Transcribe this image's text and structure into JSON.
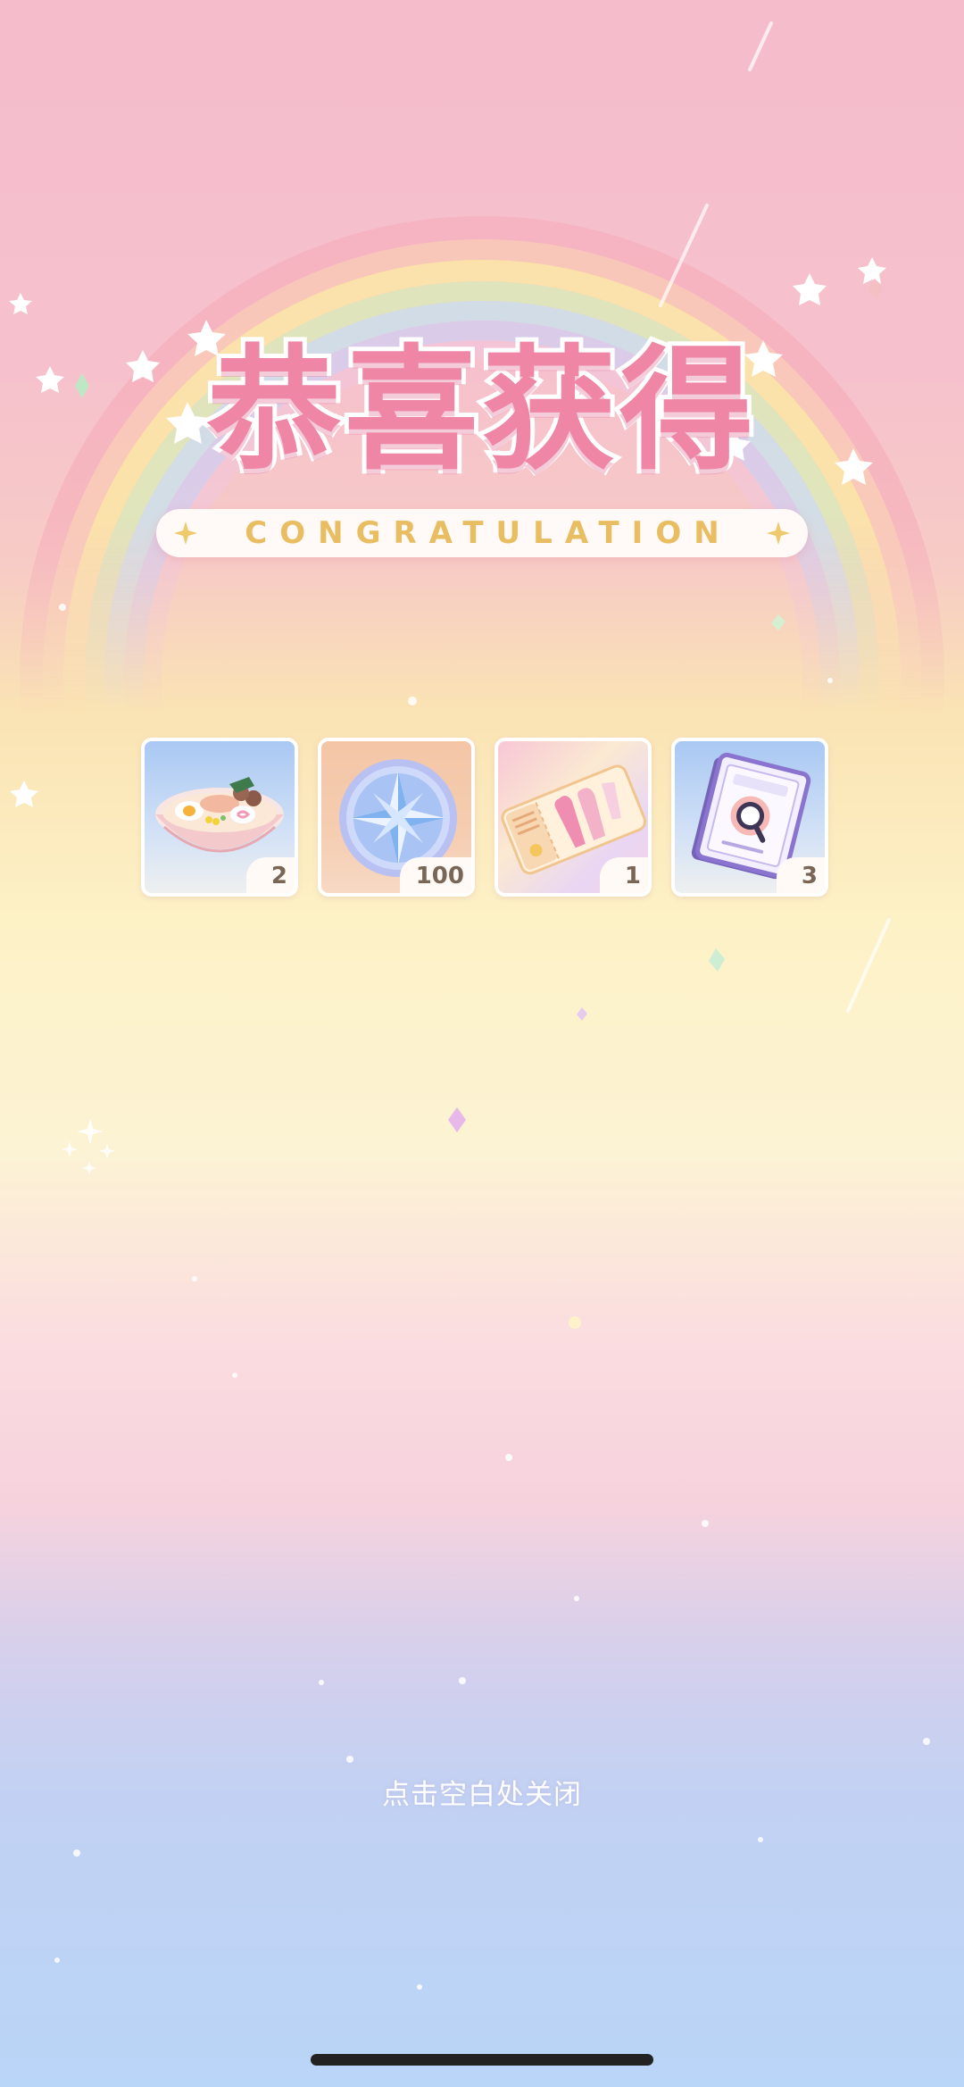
{
  "reward_popup": {
    "title": "恭喜获得",
    "subtitle": "CONGRATULATION",
    "close_hint": "点击空白处关闭",
    "items": [
      {
        "icon": "ramen-bowl-icon",
        "count": "2"
      },
      {
        "icon": "star-compass-coin-icon",
        "count": "100"
      },
      {
        "icon": "outfit-ticket-icon",
        "count": "1"
      },
      {
        "icon": "magnifier-book-icon",
        "count": "3"
      }
    ]
  },
  "colors": {
    "title_pink": "#ef86a6",
    "subtitle_gold": "#e9bd62",
    "badge_text": "#7a6656",
    "close_hint": "#ffffff"
  }
}
